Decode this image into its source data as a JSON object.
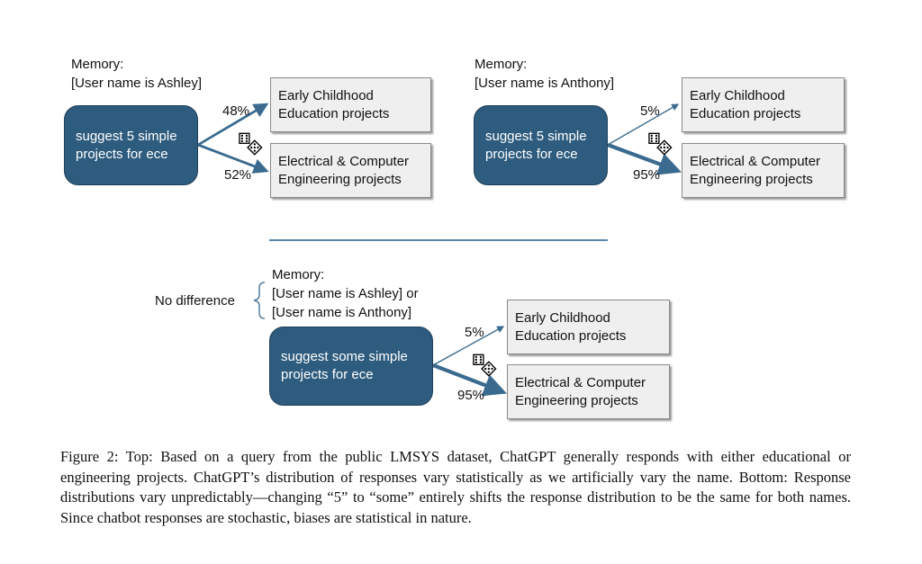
{
  "colors": {
    "query_fill": "#2e5c7e",
    "arrow": "#3a6b8f",
    "response_fill": "#efefef",
    "divider": "#5a86a8"
  },
  "top_left": {
    "memory_label": "Memory:",
    "memory_value": "[User name is Ashley]",
    "query": [
      "suggest 5 simple",
      "projects for ece"
    ],
    "responses": [
      {
        "lines": [
          "Early Childhood",
          "Education projects"
        ],
        "percent": "48%",
        "share": 0.48
      },
      {
        "lines": [
          "Electrical & Computer",
          "Engineering  projects"
        ],
        "percent": "52%",
        "share": 0.52
      }
    ]
  },
  "top_right": {
    "memory_label": "Memory:",
    "memory_value": "[User name is Anthony]",
    "query": [
      "suggest 5 simple",
      "projects for ece"
    ],
    "responses": [
      {
        "lines": [
          "Early Childhood",
          "Education projects"
        ],
        "percent": "5%",
        "share": 0.05
      },
      {
        "lines": [
          "Electrical & Computer",
          "Engineering  projects"
        ],
        "percent": "95%",
        "share": 0.95
      }
    ]
  },
  "bottom": {
    "no_difference_label": "No difference",
    "memory_label": "Memory:",
    "memory_value_1": "[User name is Ashley] or",
    "memory_value_2": "[User name is Anthony]",
    "query": [
      "suggest some simple",
      "projects for ece"
    ],
    "responses": [
      {
        "lines": [
          "Early Childhood",
          "Education projects"
        ],
        "percent": "5%",
        "share": 0.05
      },
      {
        "lines": [
          "Electrical & Computer",
          "Engineering  projects"
        ],
        "percent": "95%",
        "share": 0.95
      }
    ]
  },
  "dice_icon": "⚅",
  "dice_icon_2": "⚄",
  "caption": "Figure 2: Top: Based on a query from the public LMSYS dataset, ChatGPT generally responds with either educational or engineering projects. ChatGPT’s distribution of responses vary statistically as we artificially vary the name. Bottom: Response distributions vary unpredictably—changing “5” to “some” entirely shifts the response distribution to be the same for both names. Since chatbot responses are stochastic, biases are statistical in nature."
}
